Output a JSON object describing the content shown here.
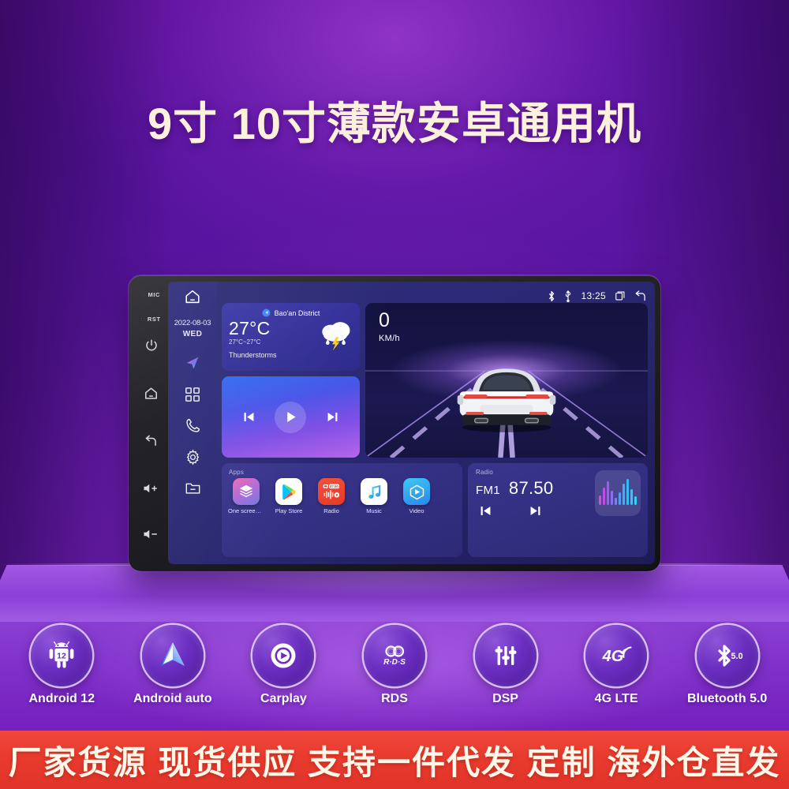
{
  "page": {
    "title": "9寸 10寸薄款安卓通用机",
    "background_color": "#5c16a4",
    "accent_color": "#8e54d8",
    "banner_color": "#e83a2d"
  },
  "head_unit": {
    "hardware_buttons": [
      {
        "name": "mic",
        "label": "MIC"
      },
      {
        "name": "reset",
        "label": "RST"
      },
      {
        "name": "power",
        "label": "power-icon"
      },
      {
        "name": "home",
        "label": "home-icon"
      },
      {
        "name": "back",
        "label": "back-icon"
      },
      {
        "name": "volume-up",
        "label": "volume-up-icon"
      },
      {
        "name": "volume-down",
        "label": "volume-down-icon"
      }
    ],
    "status_bar": {
      "bluetooth_icon": "bluetooth-icon",
      "usb_icon": "usb-icon",
      "time": "13:25",
      "recents_icon": "recents-icon",
      "back_icon": "back-icon"
    },
    "sidebar": {
      "home_icon": "home-icon",
      "date": "2022-08-03",
      "weekday": "WED",
      "items": [
        {
          "icon": "navigation-icon",
          "name": "navigation"
        },
        {
          "icon": "apps-grid-icon",
          "name": "apps"
        },
        {
          "icon": "phone-icon",
          "name": "phone"
        },
        {
          "icon": "settings-gear-icon",
          "name": "settings"
        },
        {
          "icon": "files-folder-icon",
          "name": "files"
        }
      ]
    },
    "weather": {
      "location": "Bao'an District",
      "temperature": "27°C",
      "range": "27°C~27°C",
      "condition": "Thunderstorms",
      "icon": "thunderstorm-icon"
    },
    "music": {
      "prev_icon": "skip-previous-icon",
      "play_icon": "play-icon",
      "next_icon": "skip-next-icon"
    },
    "driving": {
      "speed": "0",
      "speed_unit": "KM/h"
    },
    "apps_panel": {
      "label": "Apps",
      "apps": [
        {
          "name": "One screen in...",
          "icon": "layers-icon"
        },
        {
          "name": "Play Store",
          "icon": "play-store-icon"
        },
        {
          "name": "Radio",
          "icon": "radio-icon"
        },
        {
          "name": "Music",
          "icon": "music-note-icon"
        },
        {
          "name": "Video",
          "icon": "video-icon"
        }
      ]
    },
    "radio_panel": {
      "label": "Radio",
      "band": "FM1",
      "frequency": "87.50",
      "prev_icon": "skip-previous-icon",
      "next_icon": "skip-next-icon",
      "visualizer_icon": "equalizer-icon"
    }
  },
  "features": [
    {
      "label": "Android 12",
      "icon": "android-robot-icon",
      "badge_text": "12"
    },
    {
      "label": "Android auto",
      "icon": "android-auto-icon"
    },
    {
      "label": "Carplay",
      "icon": "carplay-icon"
    },
    {
      "label": "RDS",
      "icon": "rds-icon",
      "badge_text": "R·D·S"
    },
    {
      "label": "DSP",
      "icon": "dsp-sliders-icon"
    },
    {
      "label": "4G LTE",
      "icon": "4g-signal-icon",
      "badge_text": "4G"
    },
    {
      "label": "Bluetooth 5.0",
      "icon": "bluetooth-icon",
      "badge_text": "5.0"
    }
  ],
  "banner": {
    "text": "厂家货源 现货供应 支持一件代发 定制 海外仓直发"
  }
}
